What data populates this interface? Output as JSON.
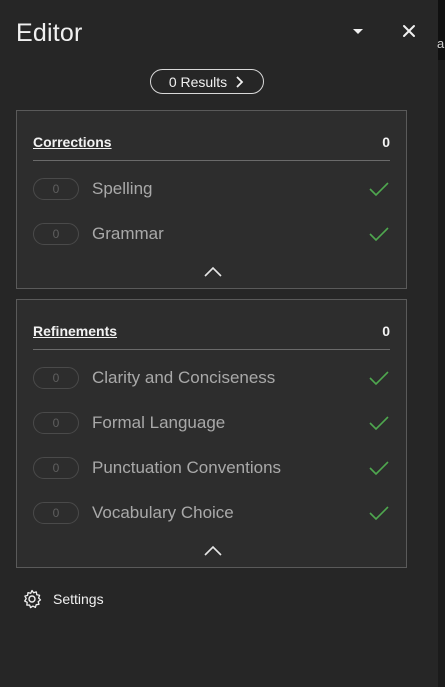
{
  "pane": {
    "title": "Editor",
    "results": {
      "label": "0 Results"
    }
  },
  "strip_text": "a",
  "corrections": {
    "heading": "Corrections",
    "count": "0",
    "items": [
      {
        "count": "0",
        "label": "Spelling"
      },
      {
        "count": "0",
        "label": "Grammar"
      }
    ]
  },
  "refinements": {
    "heading": "Refinements",
    "count": "0",
    "items": [
      {
        "count": "0",
        "label": "Clarity and Conciseness"
      },
      {
        "count": "0",
        "label": "Formal Language"
      },
      {
        "count": "0",
        "label": "Punctuation Conventions"
      },
      {
        "count": "0",
        "label": "Vocabulary Choice"
      }
    ]
  },
  "settings": {
    "label": "Settings"
  },
  "colors": {
    "background": "#262626",
    "card": "#2d2d2d",
    "check": "#4fa84f"
  },
  "icons": [
    "chevron-down-icon",
    "close-icon",
    "chevron-right-icon",
    "checkmark-icon",
    "chevron-up-icon",
    "gear-icon"
  ]
}
